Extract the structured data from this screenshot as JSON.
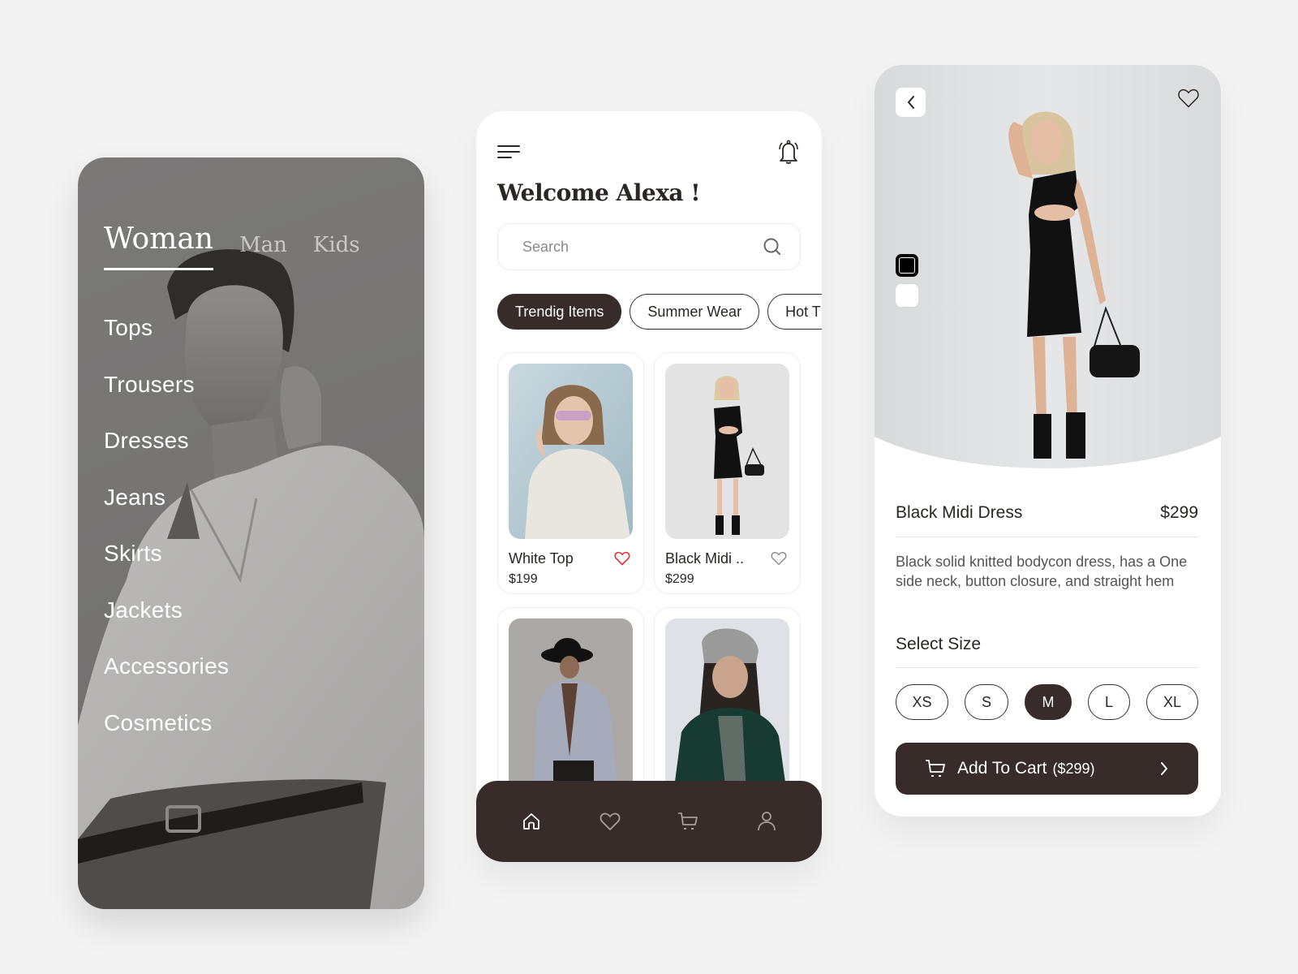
{
  "screen_categories": {
    "tabs": [
      {
        "label": "Woman",
        "active": true
      },
      {
        "label": "Man",
        "active": false
      },
      {
        "label": "Kids",
        "active": false
      }
    ],
    "menu": [
      "Tops",
      "Trousers",
      "Dresses",
      "Jeans",
      "Skirts",
      "Jackets",
      "Accessories",
      "Cosmetics"
    ]
  },
  "screen_home": {
    "title": "Welcome Alexa !",
    "search": {
      "placeholder": "Search",
      "value": ""
    },
    "chips": [
      {
        "label": "Trendig Items",
        "active": true
      },
      {
        "label": "Summer Wear",
        "active": false
      },
      {
        "label": "Hot T",
        "active": false
      }
    ],
    "products": [
      {
        "name": "White Top",
        "price": "$199",
        "favorite": true
      },
      {
        "name": "Black Midi ..",
        "price": "$299",
        "favorite": false
      },
      {
        "name": "",
        "price": "",
        "favorite": false
      },
      {
        "name": "",
        "price": "",
        "favorite": false
      }
    ],
    "nav": [
      "home-icon",
      "heart-icon",
      "cart-icon",
      "user-icon"
    ]
  },
  "screen_detail": {
    "product_name": "Black Midi Dress",
    "price": "$299",
    "description": "Black solid knitted bodycon dress, has a One side neck, button closure, and straight hem",
    "size_label": "Select Size",
    "sizes": [
      "XS",
      "S",
      "M",
      "L",
      "XL"
    ],
    "selected_size": "M",
    "colors": [
      "black",
      "white"
    ],
    "selected_color": "black",
    "cart_button": {
      "label": "Add To Cart",
      "price": "($299)"
    }
  },
  "colors": {
    "accent": "#372c29",
    "background": "#f3f3f3",
    "favorite": "#e0303a"
  }
}
